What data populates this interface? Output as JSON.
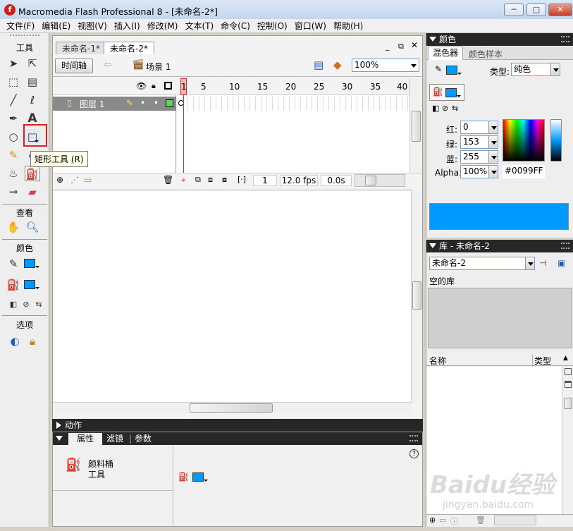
{
  "window": {
    "title": "Macromedia Flash Professional 8 - [未命名-2*]",
    "app_icon": "f",
    "minimize": "─",
    "maximize": "□",
    "close": "✕"
  },
  "menu": [
    "文件(F)",
    "编辑(E)",
    "视图(V)",
    "插入(I)",
    "修改(M)",
    "文本(T)",
    "命令(C)",
    "控制(O)",
    "窗口(W)",
    "帮助(H)"
  ],
  "toolbar": {
    "tools_label": "工具",
    "view_label": "查看",
    "colors_label": "颜色",
    "options_label": "选项",
    "tooltip": "矩形工具 (R)",
    "selected_tool": "rectangle-tool",
    "stroke_color": "#0099ff",
    "fill_color": "#0099ff"
  },
  "document": {
    "tabs": [
      "未命名-1*",
      "未命名-2*"
    ],
    "active_tab": 1,
    "timeline_button": "时间轴",
    "scene_label": "场景 1",
    "zoom": "100%",
    "layer_name": "图层 1",
    "frame_ticks": [
      "1",
      "5",
      "10",
      "15",
      "20",
      "25",
      "30",
      "35",
      "40"
    ],
    "current_frame": "1",
    "fps": "12.0 fps",
    "elapsed": "0.0s"
  },
  "actions_panel": {
    "title": "动作"
  },
  "properties_panel": {
    "tabs": [
      "属性",
      "滤镜",
      "参数"
    ],
    "tool_name_line1": "颜料桶",
    "tool_name_line2": "工具",
    "help": "?"
  },
  "color_panel": {
    "title": "颜色",
    "tabs": [
      "混色器",
      "颜色样本"
    ],
    "type_label": "类型:",
    "type_value": "纯色",
    "red_label": "红:",
    "red_value": "0",
    "green_label": "绿:",
    "green_value": "153",
    "blue_label": "蓝:",
    "blue_value": "255",
    "alpha_label": "Alpha:",
    "alpha_value": "100%",
    "hex_value": "#0099FF",
    "preview_color": "#0099ff"
  },
  "library_panel": {
    "title": "库 - 未命名-2",
    "doc_select": "未命名-2",
    "empty_text": "空的库",
    "col_name": "名称",
    "col_type": "类型"
  },
  "watermark": {
    "brand": "Baidu经验",
    "url": "jingyan.baidu.com"
  }
}
